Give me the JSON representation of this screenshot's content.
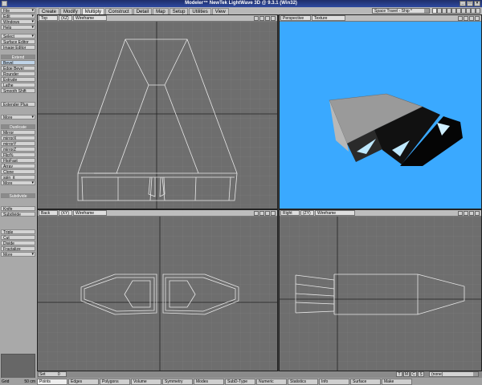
{
  "window": {
    "title": "Modeler™ NewTek LightWave 3D @ 9.3.1 (Win32)"
  },
  "tabs": [
    "Create",
    "Modify",
    "Multiply",
    "Construct",
    "Detail",
    "Map",
    "Setup",
    "Utilities",
    "View"
  ],
  "active_tab": "Multiply",
  "scene_select": "Space Travel - Ship *",
  "left_toolbar": {
    "file": "File",
    "edit": "Edit",
    "windows": "Windows",
    "help": "Help",
    "select": "Select",
    "surface_editor": "Surface Editor",
    "image_editor": "Image Editor",
    "extend_header": "Extend",
    "extend": [
      "Bevel",
      "Edge Bevel",
      "Rounder",
      "Extrude",
      "Lathe",
      "Smooth Shift"
    ],
    "extender_plus": "Extender Plus",
    "more1": "More",
    "duplicate_header": "Duplicate",
    "duplicate": [
      "Mirror",
      "mirrorX",
      "mirrorY",
      "mirrorZ",
      "Flip%",
      "FlipFast",
      "Array",
      "Clone",
      "spin_it"
    ],
    "more2": "More",
    "subdivide_header": "Subdivide",
    "knife": "Knife",
    "subdivide": "Subdivide",
    "triple": "Triple",
    "cut": "Cut",
    "divide": "Divide",
    "fractalize": "Fractalize",
    "more3": "More"
  },
  "viewports": {
    "top": {
      "view": "Top",
      "axes": "(XZ)",
      "mode": "Wireframe"
    },
    "perspective": {
      "view": "Perspective",
      "mode": "Texture"
    },
    "back": {
      "view": "Back",
      "axes": "(XY)",
      "mode": "Wireframe"
    },
    "right": {
      "view": "Right",
      "axes": "(ZY)",
      "mode": "Wireframe"
    }
  },
  "bottom": {
    "set_label": "Set",
    "set_value": "0",
    "tmcs": [
      "T",
      "M",
      "C",
      "S"
    ],
    "vmap": "(none)",
    "grid_label": "Grid",
    "grid_value": "50 cm",
    "modes": [
      "Points",
      "Edges",
      "Polygons",
      "Volume",
      "Symmetry",
      "Modes",
      "SubD-Type",
      "Numeric",
      "Statistics",
      "Info",
      "Surface",
      "Make"
    ],
    "active_mode": "Points"
  },
  "colors": {
    "viewport_bg": "#6e6e6e",
    "perspective_bg": "#3aa9ff",
    "wire": "#e8e8e8",
    "title_blue": "#2e4aa0"
  }
}
